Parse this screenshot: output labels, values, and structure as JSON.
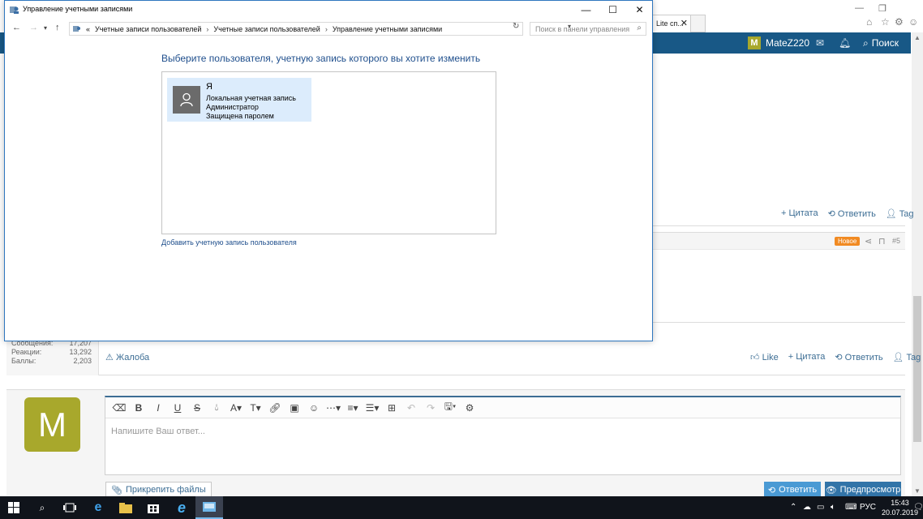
{
  "browser": {
    "tab_label": "Lite сп...",
    "user_name": "MateZ220",
    "user_initial": "M",
    "search_label": "Поиск"
  },
  "posts": {
    "post1_actions": [
      "+ Цитата",
      "Ответить",
      "Tag"
    ],
    "post2": {
      "badge": "Новое",
      "number": "#5",
      "stats": [
        {
          "label": "Сообщения:",
          "value": "17,207"
        },
        {
          "label": "Реакции:",
          "value": "13,292"
        },
        {
          "label": "Баллы:",
          "value": "2,203"
        }
      ],
      "complaint": "Жалоба",
      "actions": [
        "Like",
        "+ Цитата",
        "Ответить",
        "Tag"
      ]
    }
  },
  "reply": {
    "avatar_initial": "M",
    "placeholder": "Напишите Ваш ответ...",
    "attach_label": "Прикрепить файлы",
    "reply_button": "Ответить",
    "preview_button": "Предпросмотр"
  },
  "control_panel": {
    "window_title": "Управление учетными записями",
    "breadcrumb": [
      "«",
      "Учетные записи пользователей",
      "Учетные записи пользователей",
      "Управление учетными записями"
    ],
    "search_placeholder": "Поиск в панели управления",
    "heading": "Выберите пользователя, учетную запись которого вы хотите изменить",
    "account": {
      "name": "Я",
      "type": "Локальная учетная запись",
      "role": "Администратор",
      "status": "Защищена паролем"
    },
    "add_link": "Добавить учетную запись пользователя"
  },
  "taskbar": {
    "language": "РУС",
    "time": "15:43",
    "date": "20.07.2019"
  },
  "colors": {
    "site_header": "#185886",
    "accent_link": "#1e4e8c",
    "badge_new": "#f18a22",
    "avatar": "#a8a82c"
  }
}
